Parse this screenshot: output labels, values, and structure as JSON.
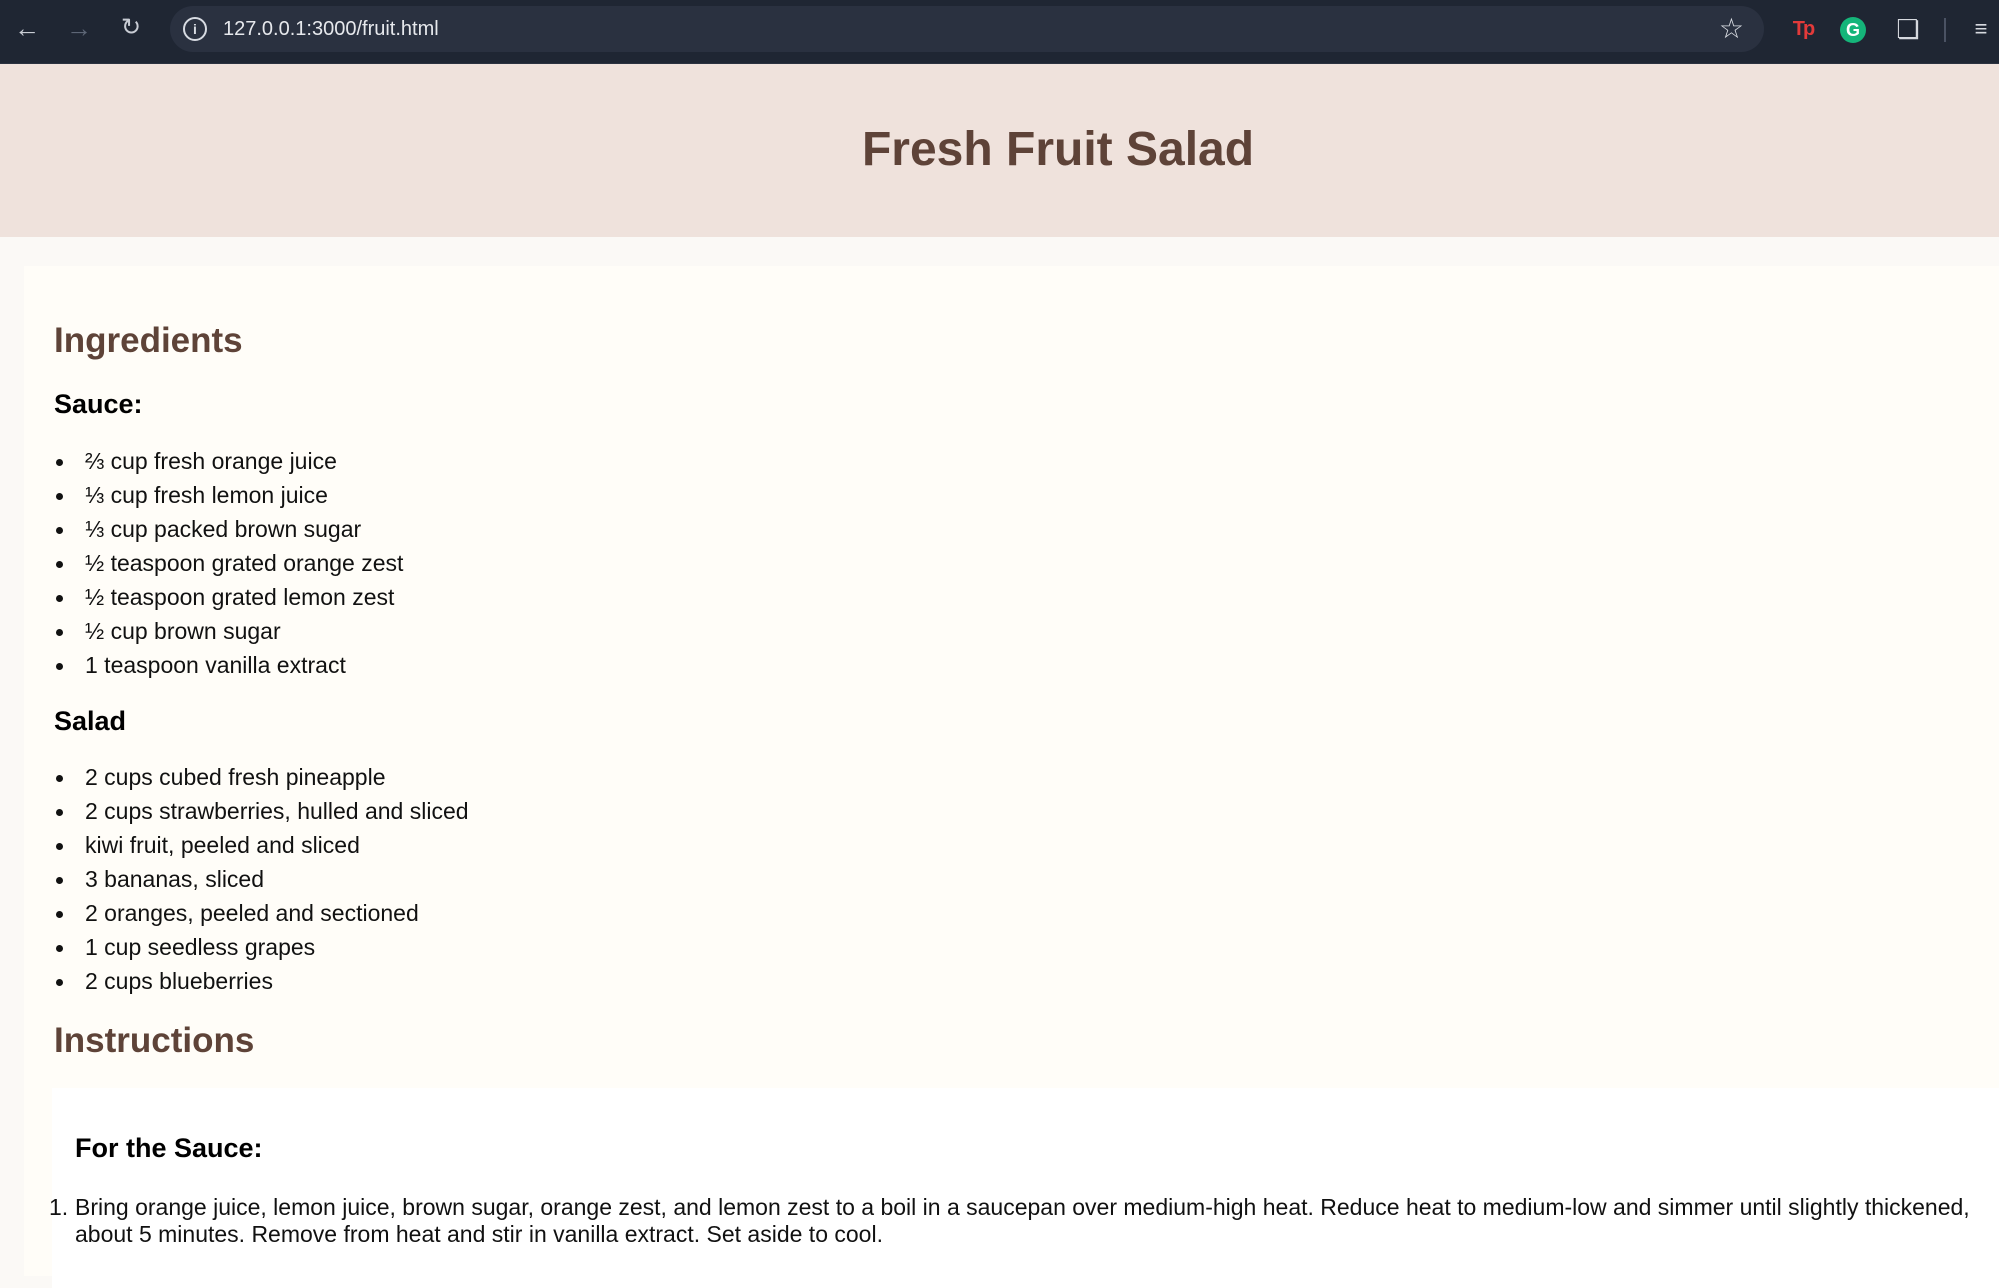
{
  "browser": {
    "url": "127.0.0.1:3000/fruit.html"
  },
  "page": {
    "title": "Fresh Fruit Salad"
  },
  "ingredients": {
    "heading": "Ingredients",
    "sauce": {
      "heading": "Sauce:",
      "items": [
        "⅔ cup fresh orange juice",
        "⅓ cup fresh lemon juice",
        "⅓ cup packed brown sugar",
        "½ teaspoon grated orange zest",
        "½ teaspoon grated lemon zest",
        "½ cup brown sugar",
        "1 teaspoon vanilla extract"
      ]
    },
    "salad": {
      "heading": "Salad",
      "items": [
        "2 cups cubed fresh pineapple",
        "2 cups strawberries, hulled and sliced",
        "kiwi fruit, peeled and sliced",
        "3 bananas, sliced",
        "2 oranges, peeled and sectioned",
        "1 cup seedless grapes",
        "2 cups blueberries"
      ]
    }
  },
  "instructions": {
    "heading": "Instructions",
    "sauce_heading": "For the Sauce:",
    "steps": [
      {
        "number": "1.",
        "line1": "Bring orange juice, lemon juice, brown sugar, orange zest, and lemon zest to a boil in a saucepan over medium-high heat. Reduce heat to medium-low and simmer until slightly thickened,",
        "line2": "about 5 minutes. Remove from heat and stir in vanilla extract. Set aside to cool."
      }
    ]
  }
}
